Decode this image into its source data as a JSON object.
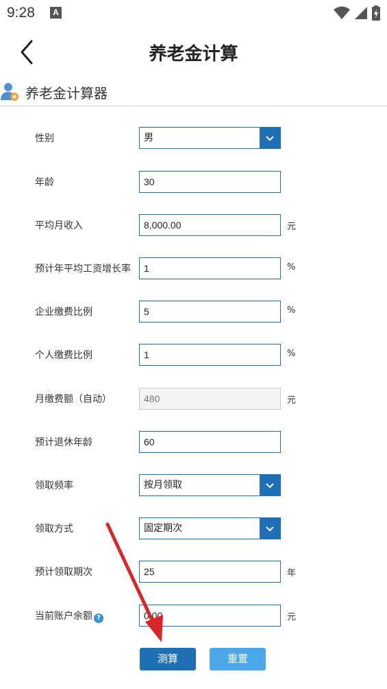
{
  "status_bar": {
    "time": "9:28",
    "notification_letter": "A"
  },
  "header": {
    "title": "养老金计算"
  },
  "section": {
    "title": "养老金计算器"
  },
  "form": {
    "rows": [
      {
        "label": "性别",
        "value": "男",
        "kind": "select"
      },
      {
        "label": "年龄",
        "value": "30",
        "kind": "input"
      },
      {
        "label": "平均月收入",
        "value": "8,000.00",
        "unit": "元",
        "kind": "input"
      },
      {
        "label": "预计年平均工资增长率",
        "value": "1",
        "unit": "%",
        "kind": "input"
      },
      {
        "label": "企业缴费比例",
        "value": "5",
        "unit": "%",
        "kind": "input"
      },
      {
        "label": "个人缴费比例",
        "value": "1",
        "unit": "%",
        "kind": "input"
      },
      {
        "label": "月缴费额（自动）",
        "value": "480",
        "unit": "元",
        "kind": "readonly"
      },
      {
        "label": "预计退休年龄",
        "value": "60",
        "kind": "input"
      },
      {
        "label": "领取频率",
        "value": "按月领取",
        "kind": "select"
      },
      {
        "label": "领取方式",
        "value": "固定期次",
        "kind": "select"
      },
      {
        "label": "预计领取期次",
        "value": "25",
        "unit": "年",
        "kind": "input"
      },
      {
        "label": "当前账户余额",
        "value": "0.00",
        "unit": "元",
        "kind": "input",
        "help_icon": "?"
      }
    ]
  },
  "buttons": {
    "calculate": "测算",
    "reset": "重置"
  },
  "colors": {
    "primary": "#1f6fb5",
    "secondary_button": "#4da8ea",
    "annotation_arrow": "#d8262b"
  },
  "icons": {
    "back": "chevron-left-icon",
    "section": "user-gear-icon",
    "select_arrow": "chevron-down-icon",
    "help": "question-circle-icon"
  }
}
